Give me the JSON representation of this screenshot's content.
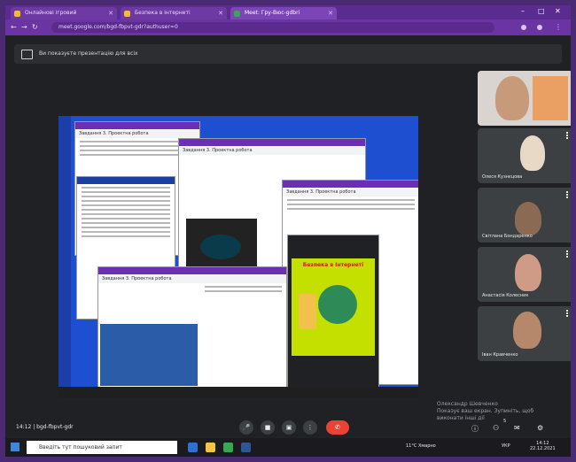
{
  "browser": {
    "tabs": [
      {
        "label": "Онлайнові ігровий",
        "active": false,
        "color": "#f6b93b"
      },
      {
        "label": "Безпека в інтернеті",
        "active": false,
        "color": "#f6b93b"
      },
      {
        "label": "Meet: Гру-Вюс-gdbri",
        "active": true,
        "color": "#34a853"
      }
    ],
    "url": "meet.google.com/bgd-fbpvt-gdr?authuser=0",
    "window_controls": {
      "minimize": "–",
      "maximize": "□",
      "close": "✕"
    }
  },
  "meet": {
    "banner_text": "Ви показуєте презентацію для всіх",
    "participants": [
      {
        "name": ""
      },
      {
        "name": "Олеся Кузнєцова"
      },
      {
        "name": "Світлана Бондаренко"
      },
      {
        "name": "Анастасія Колесник"
      },
      {
        "name": "Іван Кравченко"
      }
    ],
    "speaker_caption": [
      "Олександр Шевченко",
      "Показує ваш екран. Зупиніть, щоб",
      "виконати інші дії"
    ],
    "time": "14:12",
    "meeting_code": "bgd-fbpvt-gdr",
    "controls": {
      "mic": "🎤",
      "camera": "■",
      "present": "▣",
      "more": "⋮",
      "end": "✆"
    },
    "right_controls": {
      "info": "ⓘ",
      "people": "⚇",
      "chat": "✉",
      "activities": "⚙"
    },
    "right_badge": "5",
    "presentation_window_titles": [
      "Завдання 3. Проектна робота",
      "Завдання 3. Проектна робота",
      "Завдання 3. Проектна робота",
      "Завдання 3. Проектна робота",
      "Безпека в Інтернеті"
    ]
  },
  "taskbar": {
    "search_placeholder": "Введіть тут пошуковий запит",
    "weather": "11°C Хмарно",
    "language": "УКР",
    "clock_time": "14:12",
    "clock_date": "22.12.2021"
  }
}
